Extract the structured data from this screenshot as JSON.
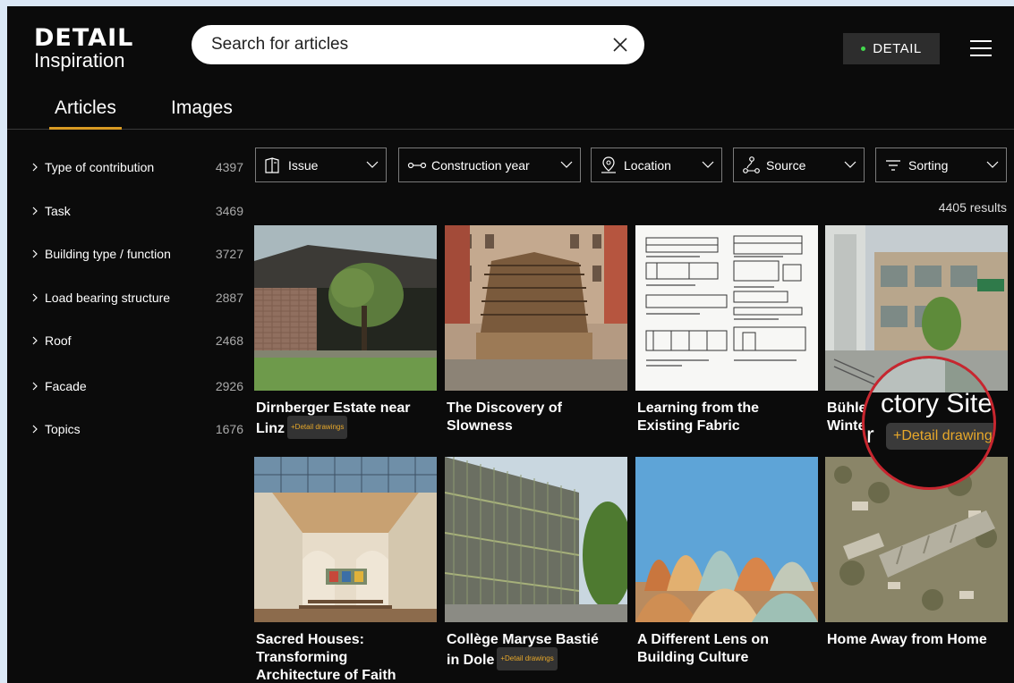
{
  "logo": {
    "line1": "DETAIL",
    "line2": "Inspiration"
  },
  "search": {
    "placeholder": "Search for articles"
  },
  "header": {
    "detail_button": "DETAIL"
  },
  "tabs": [
    {
      "label": "Articles",
      "active": true
    },
    {
      "label": "Images",
      "active": false
    }
  ],
  "sidebar": {
    "items": [
      {
        "label": "Type of contribution",
        "count": "4397"
      },
      {
        "label": "Task",
        "count": "3469"
      },
      {
        "label": "Building type / function",
        "count": "3727"
      },
      {
        "label": "Load bearing structure",
        "count": "2887"
      },
      {
        "label": "Roof",
        "count": "2468"
      },
      {
        "label": "Facade",
        "count": "2926"
      },
      {
        "label": "Topics",
        "count": "1676"
      }
    ]
  },
  "filters": [
    {
      "label": "Issue",
      "icon": "book-icon"
    },
    {
      "label": "Construction year",
      "icon": "timeline-icon"
    },
    {
      "label": "Location",
      "icon": "location-pin-icon"
    },
    {
      "label": "Source",
      "icon": "route-icon"
    },
    {
      "label": "Sorting",
      "icon": "sort-icon"
    }
  ],
  "results_text": "4405 results",
  "cards": [
    {
      "title_line1": "Dirnberger Estate near",
      "title_line2": "Linz",
      "badge": "+Detail drawings"
    },
    {
      "title_line1": "The Discovery of",
      "title_line2": "Slowness",
      "badge": ""
    },
    {
      "title_line1": "Learning from the",
      "title_line2": "Existing Fabric",
      "badge": ""
    },
    {
      "title_line1": "Bühle",
      "title_line2": "Winte",
      "badge": ""
    },
    {
      "title_line1": "Sacred Houses:",
      "title_line2": "Transforming",
      "title_line3": "Architecture of Faith",
      "badge": ""
    },
    {
      "title_line1": "Collège Maryse Bastié",
      "title_line2": "in Dole",
      "badge": "+Detail drawings"
    },
    {
      "title_line1": "A Different Lens on",
      "title_line2": "Building Culture",
      "badge": ""
    },
    {
      "title_line1": "Home Away from Home",
      "title_line2": "",
      "badge": ""
    }
  ],
  "zoom": {
    "text_large": "ctory Site ir",
    "text_r": "r",
    "badge": "+Detail drawings"
  },
  "colors": {
    "accent": "#d89a23",
    "badge_text": "#e7a82a",
    "zoom_ring": "#c8262f",
    "status_dot": "#43d94d"
  }
}
